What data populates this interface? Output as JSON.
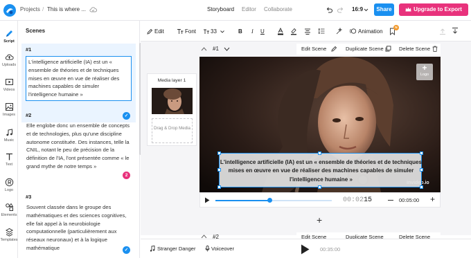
{
  "topbar": {
    "projects": "Projects",
    "separator": "/",
    "project_title": "This is where ...",
    "modes": [
      "Storyboard",
      "Editor",
      "Collaborate"
    ],
    "aspect": "16:9",
    "share": "Share",
    "upgrade": "Upgrade to Export"
  },
  "rail": [
    {
      "label": "Script",
      "icon": "script-icon"
    },
    {
      "label": "Uploads",
      "icon": "upload-icon"
    },
    {
      "label": "Videos",
      "icon": "video-icon"
    },
    {
      "label": "Images",
      "icon": "image-icon"
    },
    {
      "label": "Music",
      "icon": "music-icon"
    },
    {
      "label": "Text",
      "icon": "text-icon"
    },
    {
      "label": "Logo",
      "icon": "logo-icon"
    },
    {
      "label": "Elements",
      "icon": "elements-icon"
    },
    {
      "label": "Templates",
      "icon": "templates-icon"
    }
  ],
  "scenes": {
    "title": "Scenes",
    "items": [
      {
        "num": "#1",
        "text": "L'intelligence artificielle (IA) est un « ensemble de théories et de techniques mises en œuvre en vue de réaliser des machines capables de simuler l'intelligence humaine »"
      },
      {
        "num": "#2",
        "text": "Elle englobe donc un ensemble de concepts et de technologies, plus qu'une discipline autonome constituée. Des instances, telle la CNIL, notant le peu de précision de la définition de l'IA, l'ont présentée comme « le grand mythe de notre temps »",
        "badge": "2"
      },
      {
        "num": "#3",
        "text": "Souvent classée dans le groupe des mathématiques et des sciences cognitives, elle fait appel à la neurobiologie computationnelle (particulièrement aux réseaux neuronaux) et à la logique mathématique"
      }
    ]
  },
  "toolbar": {
    "edit": "Edit",
    "font": "Font",
    "size": "33",
    "bold": "B",
    "italic": "I",
    "underline": "U",
    "animation": "Animation",
    "notif_badge": "N"
  },
  "media": {
    "layer": "Media layer 1",
    "drop": "Drag & Drop Media"
  },
  "scene_head": {
    "num": "#1",
    "edit": "Edit Scene",
    "duplicate": "Duplicate Scene",
    "delete": "Delete Scene"
  },
  "scene_head2": {
    "num": "#2",
    "edit": "Edit Scene",
    "duplicate": "Duplicate Scene",
    "delete": "Delete Scene"
  },
  "video": {
    "logo_plus": "+",
    "logo_label": "Logo",
    "caption": "L'intelligence artificielle (IA) est un « ensemble de théories et de techniques mises en œuvre en vue de réaliser des machines capables de simuler l'intelligence humaine »",
    "watermark": "invideo.io"
  },
  "controls": {
    "time_current": "00:02",
    "time_frac": "15",
    "duration": "00:05:00",
    "progress": 0.47
  },
  "footer": {
    "music": "Stranger Danger",
    "voiceover": "Voiceover",
    "total": "00:35:00"
  },
  "colors": {
    "accent": "#1a90f0",
    "upgrade": "#e8327c",
    "badge_red": "#e8327c"
  }
}
